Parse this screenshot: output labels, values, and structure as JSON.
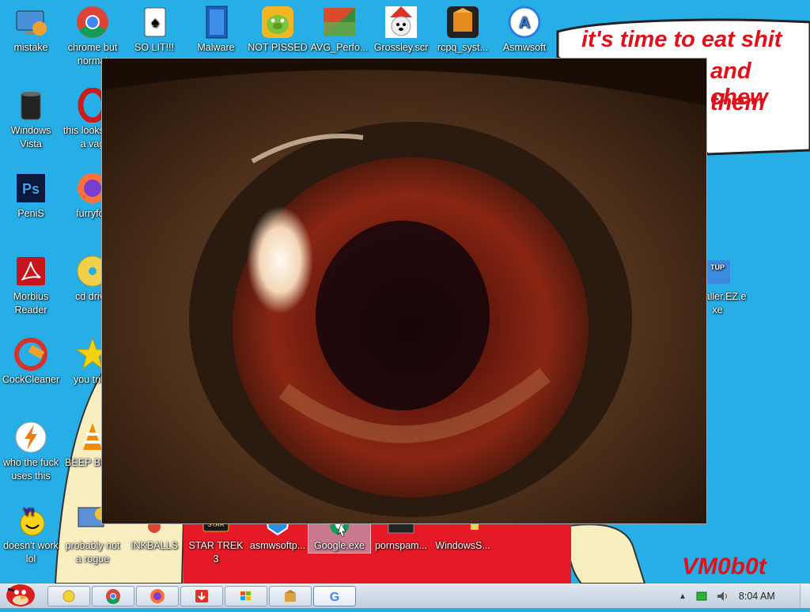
{
  "desktop": {
    "speech_bubble": {
      "lines": [
        "it's time to eat shit",
        "and chew",
        "them"
      ]
    },
    "signature": "VM0b0t",
    "icons": [
      {
        "name": "mistake",
        "label": "mistake"
      },
      {
        "name": "chrome",
        "label": "chrome but normal"
      },
      {
        "name": "so-lit",
        "label": "SO LIT!!!"
      },
      {
        "name": "malware",
        "label": "Malware"
      },
      {
        "name": "not-pissed",
        "label": "NOT PISSED"
      },
      {
        "name": "avg",
        "label": "AVG_Perfo..."
      },
      {
        "name": "grossley",
        "label": "Grossley.scr"
      },
      {
        "name": "rcpq",
        "label": "rcpq_syst..."
      },
      {
        "name": "asmwsoft",
        "label": "Asmwsoft"
      },
      {
        "name": "windows-vista",
        "label": "Windows Vista"
      },
      {
        "name": "opera",
        "label": "this looks like a vag"
      },
      {
        "name": "photoshop",
        "label": "PeniS"
      },
      {
        "name": "firefox",
        "label": "furryfox"
      },
      {
        "name": "morbius",
        "label": "Morbius Reader"
      },
      {
        "name": "cd-drive",
        "label": "cd drive"
      },
      {
        "name": "setup",
        "label": "Installer.EZ.exe"
      },
      {
        "name": "ccleaner",
        "label": "CockCleaner"
      },
      {
        "name": "star",
        "label": "you tried"
      },
      {
        "name": "winamp",
        "label": "who the fuck uses this"
      },
      {
        "name": "vlc",
        "label": "BEEP BEEP"
      },
      {
        "name": "yahoo",
        "label": "doesn't work lol"
      },
      {
        "name": "rogue",
        "label": "probably not a rogue"
      },
      {
        "name": "inkballs",
        "label": "INKBALLS"
      },
      {
        "name": "star-trek",
        "label": "STAR TREK 3"
      },
      {
        "name": "asmwsoft-pc",
        "label": "asmwsoftp..."
      },
      {
        "name": "google-exe",
        "label": "Google.exe"
      },
      {
        "name": "pornspam",
        "label": "pornspam..."
      },
      {
        "name": "windows-s",
        "label": "WindowsS..."
      }
    ]
  },
  "taskbar": {
    "buttons": [
      {
        "name": "angry-birds-start",
        "icon": "angry-bird-icon"
      },
      {
        "name": "explorer",
        "icon": "folder-icon"
      },
      {
        "name": "chrome",
        "icon": "chrome-icon"
      },
      {
        "name": "firefox",
        "icon": "firefox-icon"
      },
      {
        "name": "downloader",
        "icon": "download-icon"
      },
      {
        "name": "windows-app",
        "icon": "windows-flag-icon"
      },
      {
        "name": "package",
        "icon": "package-icon"
      },
      {
        "name": "google",
        "icon": "google-icon"
      }
    ],
    "clock": "8:04 AM"
  },
  "colors": {
    "desktop_blue": "#27aee6",
    "doodle_red": "#e1101a",
    "beige": "#f8eec0"
  }
}
